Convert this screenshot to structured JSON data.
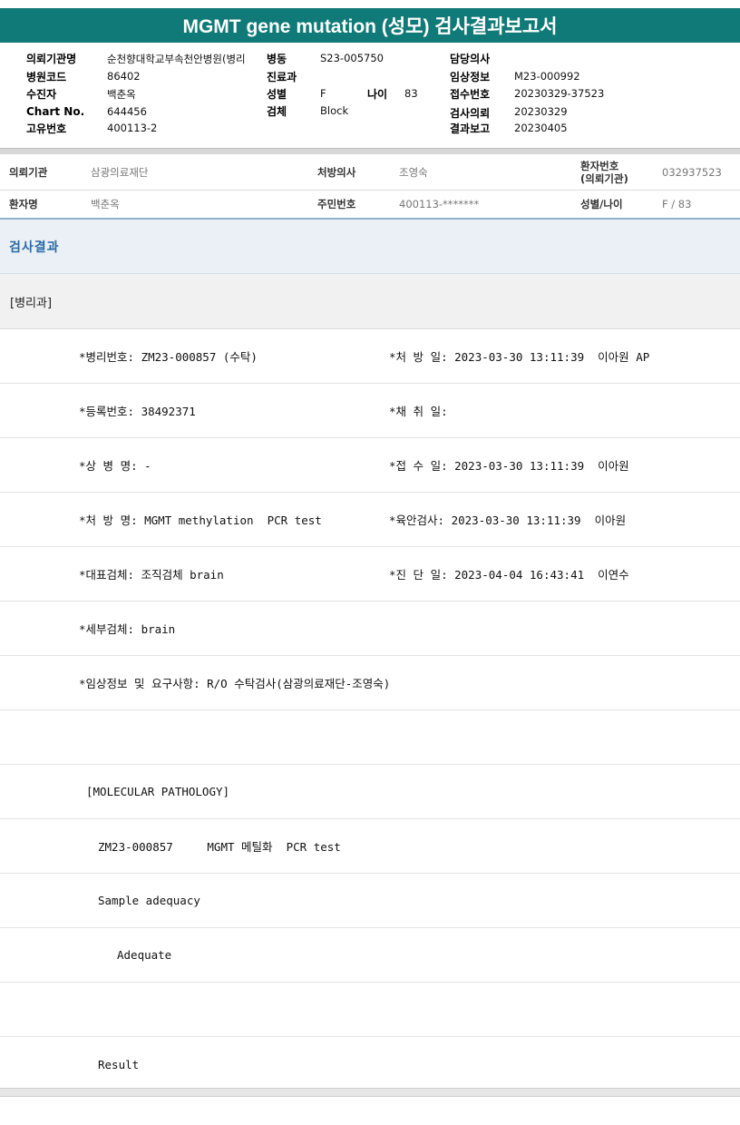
{
  "title": "MGMT gene mutation (성모) 검사결과보고서",
  "info": {
    "requesting_org_label": "의뢰기관명",
    "requesting_org_value": "순천향대학교부속천안병원(병리",
    "ward_label": "병동",
    "ward_value": "S23-005750",
    "doctor_label": "담당의사",
    "doctor_value": "",
    "hospital_code_label": "병원코드",
    "hospital_code_value": "86402",
    "department_label": "진료과",
    "department_value": "",
    "clinical_info_label": "임상정보",
    "clinical_info_value": "M23-000992",
    "recipient_label": "수진자",
    "recipient_value": "백춘옥",
    "sex_label": "성별",
    "sex_value": "F",
    "age_label": "나이",
    "age_value": "83",
    "receipt_no_label": "접수번호",
    "receipt_no_value": "20230329-37523",
    "chart_no_label": "Chart No.",
    "chart_no_value": "644456",
    "specimen_label": "검체",
    "specimen_value": "Block",
    "test_request_label": "검사의뢰",
    "test_request_value": "20230329",
    "unique_no_label": "고유번호",
    "unique_no_value": "400113-2",
    "result_report_label": "결과보고",
    "result_report_value": "20230405"
  },
  "patient": {
    "org_label": "의뢰기관",
    "org_value": "삼광의료재단",
    "prescriber_label": "처방의사",
    "prescriber_value": "조영숙",
    "patient_no_label_1": "환자번호",
    "patient_no_label_2": "(의뢰기관)",
    "patient_no_value": "032937523",
    "name_label": "환자명",
    "name_value": "백춘옥",
    "rrn_label": "주민번호",
    "rrn_value": "400113-*******",
    "sex_age_label": "성별/나이",
    "sex_age_value": "F / 83"
  },
  "results_header": "검사결과",
  "department": "[병리과]",
  "report_lines": {
    "pathology_no": "*병리번호: ZM23-000857 (수탁)",
    "prescribed_date": "*처 방 일: 2023-03-30 13:11:39  이아원 AP",
    "registration_no": "*등록번호: 38492371",
    "collection_date": "*채 취 일:",
    "diagnosis_name": "*상 병 명: -",
    "received_date": "*접 수 일: 2023-03-30 13:11:39  이아원",
    "prescription_name": "*처 방 명: MGMT methylation  PCR test",
    "gross_exam": "*육안검사: 2023-03-30 13:11:39  이아원",
    "representative_specimen": "*대표검체: 조직검체 brain",
    "diagnosis_date": "*진 단 일: 2023-04-04 16:43:41  이연수",
    "detail_specimen": "*세부검체: brain",
    "clinical_request": "*임상정보 및 요구사항: R/O 수탁검사(삼광의료재단-조영숙)",
    "molecular_pathology": "[MOLECULAR PATHOLOGY]",
    "test_line": "ZM23-000857     MGMT 메틸화  PCR test",
    "sample_adequacy": "Sample adequacy",
    "adequate": "Adequate",
    "result": "Result"
  }
}
